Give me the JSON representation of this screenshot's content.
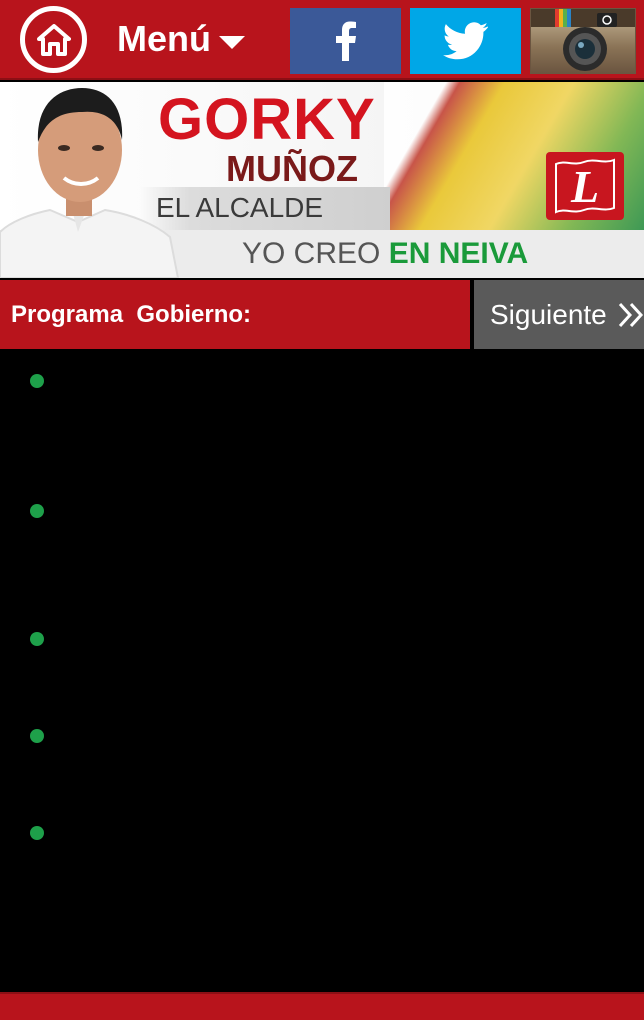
{
  "topbar": {
    "home_icon": "home-icon",
    "menu_label": "Menú",
    "social": [
      {
        "name": "facebook",
        "icon": "facebook-icon",
        "color": "#3b5998"
      },
      {
        "name": "twitter",
        "icon": "twitter-icon",
        "color": "#00a7e7"
      },
      {
        "name": "instagram",
        "icon": "instagram-icon"
      }
    ],
    "color": "#b8141c"
  },
  "banner": {
    "first_name": "GORKY",
    "last_name": "MUÑOZ",
    "role": "EL ALCALDE",
    "slogan_prefix": "YO CREO ",
    "slogan_highlight": "EN NEIVA",
    "party_logo_letter": "L",
    "party_logo_lettering": "L"
  },
  "section": {
    "title": "Programa  Gobierno:",
    "next_label": "Siguiente"
  },
  "list": {
    "bullet_color": "#1ea04a",
    "items": [
      "",
      "",
      "",
      "",
      ""
    ]
  }
}
